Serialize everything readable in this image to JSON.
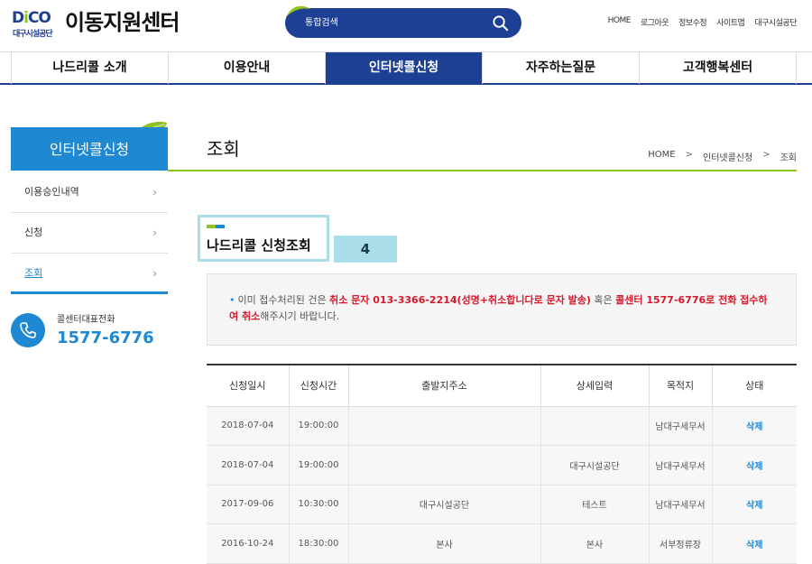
{
  "header": {
    "logo_mark": "DiCO",
    "logo_sub": "대구시설공단",
    "site_title": "이동지원센터",
    "search": {
      "placeholder": "통합검색"
    },
    "util_links": [
      "HOME",
      "로그아웃",
      "정보수정",
      "사이트맵",
      "대구시설공단"
    ]
  },
  "gnb": {
    "items": [
      {
        "label": "나드리콜 소개"
      },
      {
        "label": "이용안내"
      },
      {
        "label": "인터넷콜신청"
      },
      {
        "label": "자주하는질문"
      },
      {
        "label": "고객행복센터"
      }
    ],
    "active_index": 2
  },
  "lnb": {
    "title": "인터넷콜신청",
    "items": [
      {
        "label": "이용승인내역",
        "arrow": "›"
      },
      {
        "label": "신청",
        "arrow": "›"
      },
      {
        "label": "조회",
        "arrow": "›"
      }
    ],
    "active_index": 2,
    "callcenter": {
      "label": "콜센터대표전화",
      "number": "1577-6776"
    }
  },
  "content": {
    "page_title": "조회",
    "breadcrumb": [
      "HOME",
      "인터넷콜신청",
      "조회"
    ],
    "breadcrumb_sep": ">",
    "section_title": "나드리콜 신청조회",
    "tag": "4",
    "notice": {
      "bullet": "•",
      "part1": "이미 접수처리된 건은 ",
      "red1": "취소 문자 013-3366-2214(성명+취소합니다로 문자 발송)",
      "part2": " 혹은 ",
      "red2": "콜센터 1577-6776로 전화 접수하여 취소",
      "part3": "해주시기 바랍니다."
    },
    "table": {
      "headers": [
        "신청일시",
        "신청시간",
        "출발지주소",
        "상세입력",
        "목적지",
        "상태"
      ],
      "rows": [
        [
          "2018-07-04",
          "19:00:00",
          "",
          "",
          "남대구세무서",
          "삭제"
        ],
        [
          "2018-07-04",
          "19:00:00",
          "",
          "대구시설공단",
          "남대구세무서",
          "삭제"
        ],
        [
          "2017-09-06",
          "10:30:00",
          "대구시설공단",
          "테스트",
          "남대구세무서",
          "삭제"
        ],
        [
          "2016-10-24",
          "18:30:00",
          "본사",
          "본사",
          "서부정류장",
          "삭제"
        ]
      ]
    }
  },
  "colors": {
    "brand_navy": "#1d3f94",
    "brand_blue": "#1e88d3",
    "accent_green": "#8dc21f",
    "highlight_cyan": "#a8dde9",
    "alert_red": "#d6192c"
  }
}
